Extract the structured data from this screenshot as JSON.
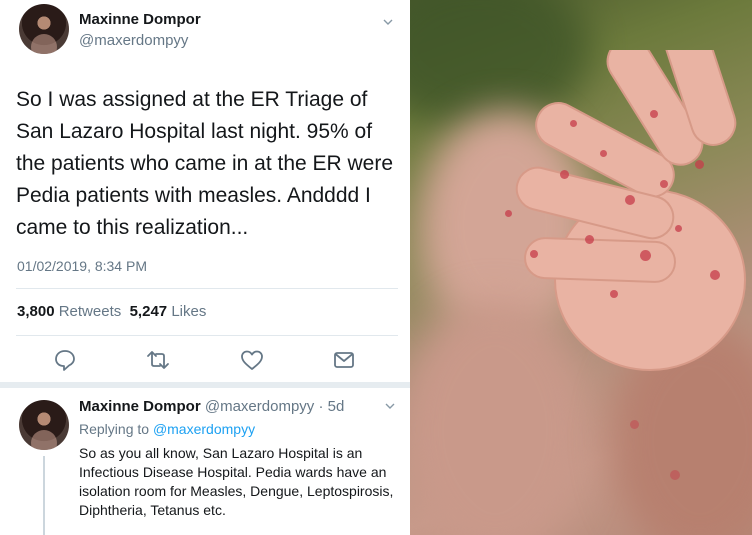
{
  "tweet": {
    "name": "Maxinne Dompor",
    "handle": "@maxerdompyy",
    "text": "So I was assigned at the ER Triage of San Lazaro Hospital last night. 95% of the patients who came in at the ER were Pedia patients with measles. Andddd I came to this realization...",
    "timestamp": "01/02/2019, 8:34 PM",
    "retweets_count": "3,800",
    "retweets_label": "Retweets",
    "likes_count": "5,247",
    "likes_label": "Likes"
  },
  "reply": {
    "name": "Maxinne Dompor",
    "handle_time": "@maxerdompyy · 5d",
    "replying_prefix": "Replying to",
    "replying_to": "@maxerdompyy",
    "text": "So as you all know, San Lazaro Hospital is an Infectious Disease Hospital. Pedia wards have an isolation room for Measles, Dengue, Leptospirosis, Diphtheria, Tetanus etc."
  },
  "icons": [
    "reply-icon",
    "retweet-icon",
    "like-icon",
    "message-icon",
    "chevron-down-icon"
  ],
  "colors": {
    "text": "#14171a",
    "secondary": "#657786",
    "link": "#1da1f2",
    "divider": "#e1e8ed",
    "measles_spots": "#c63c4a"
  }
}
